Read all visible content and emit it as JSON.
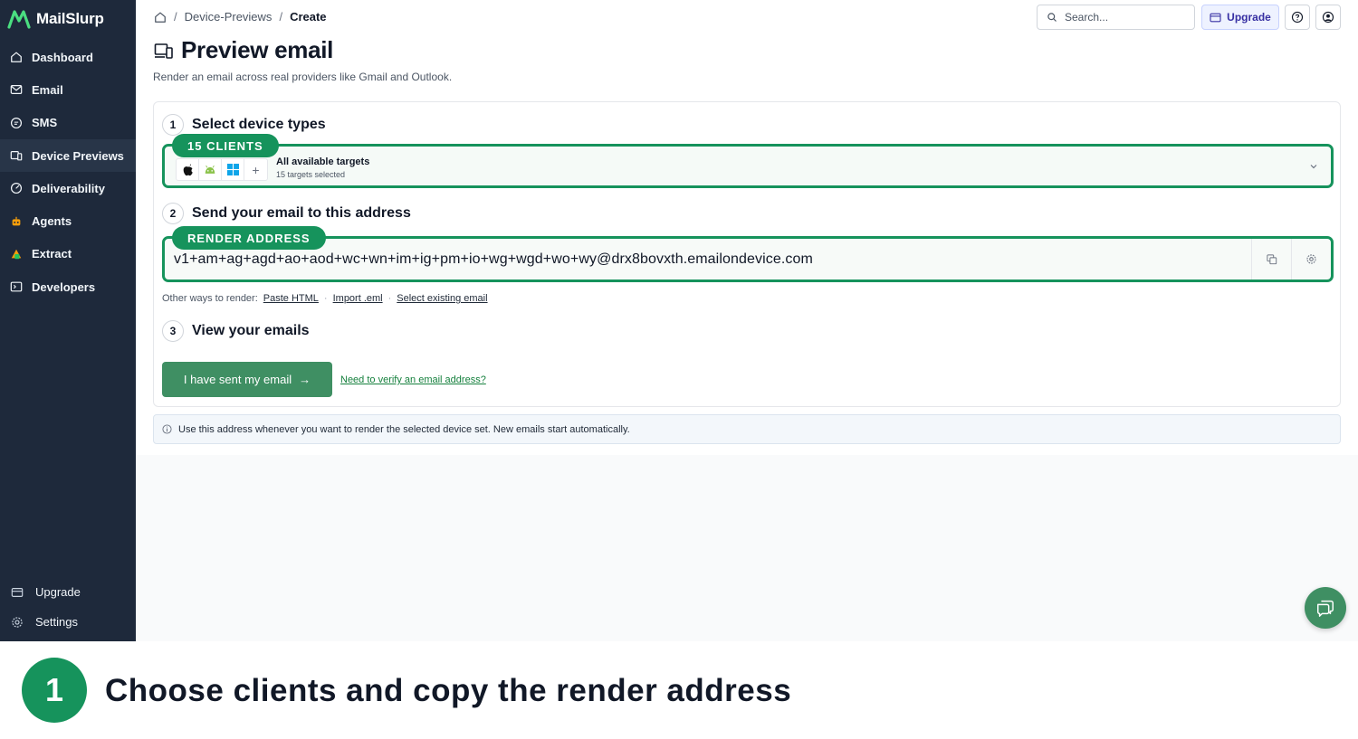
{
  "brand": {
    "name": "MailSlurp",
    "logo_icon": "mailslurp-logo-icon",
    "accent": "#16935c"
  },
  "sidebar": {
    "items": [
      {
        "label": "Dashboard",
        "icon": "home-icon"
      },
      {
        "label": "Email",
        "icon": "mail-icon"
      },
      {
        "label": "SMS",
        "icon": "chat-bubble-icon"
      },
      {
        "label": "Device Previews",
        "icon": "devices-icon"
      },
      {
        "label": "Deliverability",
        "icon": "gauge-icon"
      },
      {
        "label": "Agents",
        "icon": "robot-icon"
      },
      {
        "label": "Extract",
        "icon": "extract-icon"
      },
      {
        "label": "Developers",
        "icon": "terminal-icon"
      }
    ],
    "bottom": [
      {
        "label": "Upgrade",
        "icon": "card-icon"
      },
      {
        "label": "Settings",
        "icon": "gear-icon"
      }
    ]
  },
  "breadcrumb": {
    "section": "Device-Previews",
    "current": "Create",
    "separator": "/"
  },
  "header": {
    "search_placeholder": "Search...",
    "upgrade_label": "Upgrade"
  },
  "page": {
    "title": "Preview email",
    "subtitle": "Render an email across real providers like Gmail and Outlook."
  },
  "steps": {
    "one": {
      "number": "1",
      "title": "Select device types",
      "pill": "15 CLIENTS",
      "target_title": "All available targets",
      "target_sub": "15 targets selected",
      "add_symbol": "+"
    },
    "two": {
      "number": "2",
      "title": "Send your email to this address",
      "pill": "RENDER ADDRESS",
      "address": "v1+am+ag+agd+ao+aod+wc+wn+im+ig+pm+io+wg+wgd+wo+wy@drx8bovxth.emailondevice.com"
    },
    "other_ways": {
      "label": "Other ways to render:",
      "links": [
        "Paste HTML",
        "Import .eml",
        "Select existing email"
      ],
      "separator": "·"
    },
    "three": {
      "number": "3",
      "title": "View your emails"
    }
  },
  "actions": {
    "sent_label": "I have sent my email",
    "sent_arrow": "→",
    "verify_link": "Need to verify an email address?"
  },
  "info": "Use this address whenever you want to render the selected device set. New emails start automatically.",
  "caption": {
    "number": "1",
    "text": "Choose clients and copy the render address"
  }
}
